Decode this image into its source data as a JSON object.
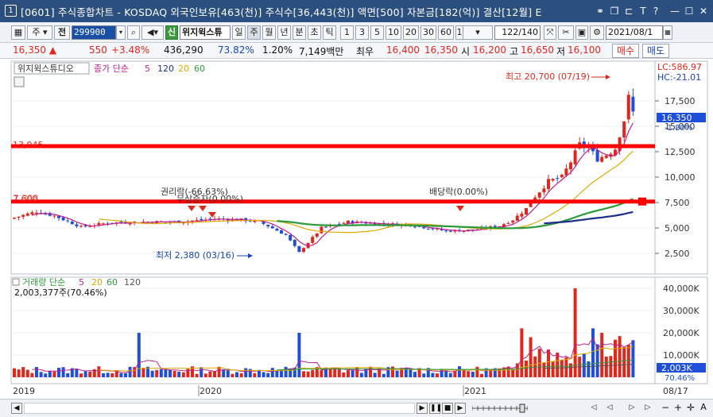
{
  "window": {
    "number": "1",
    "title": "[0601] 주식종합차트 - KOSDAQ 외국인보유[463(천)] 주식수[36,443(천)] 액면[500] 자본금[182(억)] 결산[12월] E"
  },
  "toolbar": {
    "type_label": "주",
    "jeon_label": "전",
    "code": "299900",
    "sin_label": "신",
    "stock_name": "위지윅스튜",
    "period_tabs": [
      "일",
      "주",
      "월",
      "년",
      "분",
      "초",
      "틱"
    ],
    "selected_period": "주",
    "interval_buttons": [
      "1",
      "3",
      "5",
      "10",
      "20",
      "30",
      "60",
      "120"
    ],
    "page_counter": "122/140",
    "date": "2021/08/1"
  },
  "quote": {
    "price": "16,350",
    "arrow": "▲",
    "change": "550",
    "change_pct": "+3.48%",
    "volume": "436,290",
    "turnover_pct": "73.82%",
    "rate": "1.20%",
    "amount": "7,149백만",
    "best_label": "최우",
    "bid1": "16,400",
    "bid2": "16,350",
    "open_label": "시",
    "open": "16,200",
    "high_label": "고",
    "high": "16,650",
    "low_label": "저",
    "low": "16,100",
    "buy_label": "매수",
    "sell_label": "매도"
  },
  "price_panel": {
    "stock_label": "위지윅스튜디오",
    "ma_title": "종가 단순",
    "ma_periods": [
      "5",
      "120",
      "20",
      "60"
    ],
    "ma_colors": [
      "#c0208c",
      "#1d2f8a",
      "#e0a800",
      "#2a9a3a"
    ],
    "lc": "LC:586.97",
    "hc": "HC:-21.01",
    "y_ticks": [
      "17,500",
      "15,000",
      "12,500",
      "10,000",
      "7,500",
      "5,000",
      "2,500"
    ],
    "current_price_tag": "16,350",
    "current_change_tag": "-1.80%",
    "hline_1": "13,045",
    "hline_2": "7,600",
    "hline_2_overlap": "7,308",
    "annotations": {
      "high": "최고 20,700 (07/19)",
      "low": "최저 2,380 (03/16)",
      "rights": "권리락(-66.63%)",
      "free_issue": "무상증자(0.00%)",
      "dividend": "배당락(0.00%)"
    }
  },
  "volume_panel": {
    "title": "거래량 단순",
    "ma_periods": [
      "5",
      "20",
      "60",
      "120"
    ],
    "ma_colors": [
      "#c0208c",
      "#e0a800",
      "#2a9a3a",
      "#555555"
    ],
    "value_text": "2,003,377주(70.46%)",
    "y_ticks": [
      "40,000K",
      "30,000K",
      "20,000K",
      "10,000K"
    ],
    "current_tag": "2,003K",
    "current_pct": "70.46%"
  },
  "x_axis": {
    "labels": [
      "2019",
      "2020",
      "2021",
      "08/17"
    ]
  },
  "colors": {
    "up": "#e2261b",
    "down": "#1f4fd8",
    "hline": "#ff0000",
    "titlebar": "#2b4f7e"
  }
}
